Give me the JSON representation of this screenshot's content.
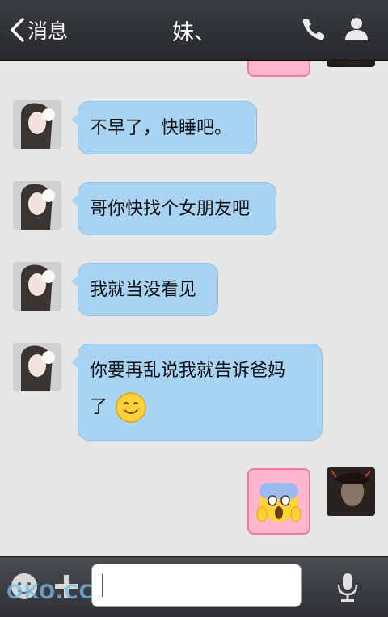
{
  "header": {
    "back_label": "消息",
    "title": "妹、",
    "icons": [
      "chevron-left-icon",
      "phone-icon",
      "contact-icon"
    ]
  },
  "messages": [
    {
      "sender": "contact",
      "text": "不早了，快睡吧。"
    },
    {
      "sender": "contact",
      "text": "哥你快找个女朋友吧"
    },
    {
      "sender": "contact",
      "text": "我就当没看见"
    },
    {
      "sender": "contact",
      "text_line1": "你要再乱说我就告诉爸妈",
      "text_line2": "了",
      "emoji": "smile-emoji"
    },
    {
      "sender": "me",
      "sticker": "scream-sticker"
    }
  ],
  "composer": {
    "input_value": "",
    "icons": [
      "emoji-face-icon",
      "plus-icon",
      "mic-icon"
    ]
  },
  "watermark": "OKO.CC",
  "colors": {
    "header_bg": "#2e3034",
    "chat_bg": "#e6e6e6",
    "bubble_bg": "#a9d3f3",
    "bubble_border": "#8fc1e6",
    "sticker_bg": "#ffb7cf"
  }
}
